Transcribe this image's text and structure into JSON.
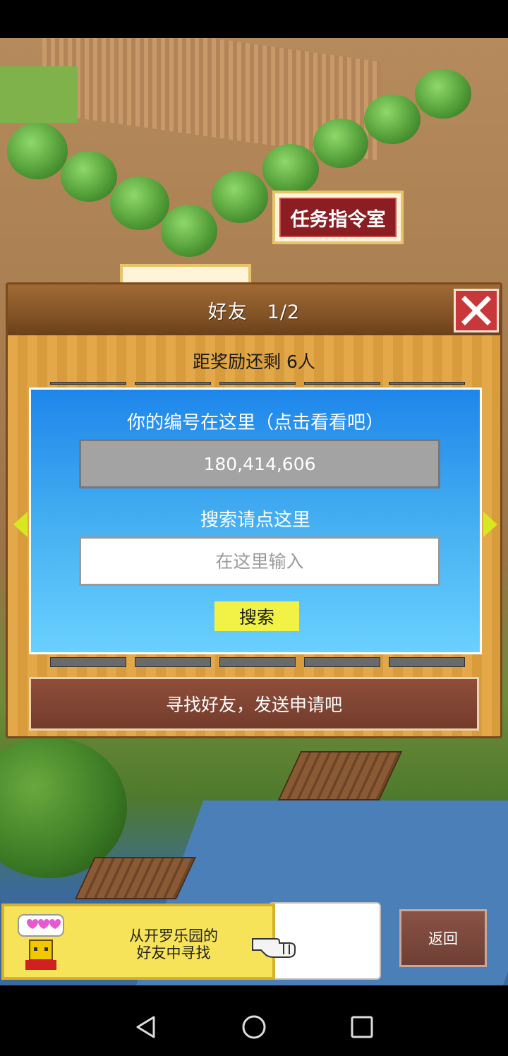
{
  "scene": {
    "mission_room_sign": "任务指令室"
  },
  "dialog": {
    "title": "好友　1/2",
    "reward_remaining": "距奖励还剩 6人",
    "id_prompt": "你的编号在这里（点击看看吧）",
    "player_id": "180,414,606",
    "search_prompt": "搜索请点这里",
    "search_placeholder": "在这里输入",
    "search_button": "搜索",
    "find_friends_button": "寻找好友，发送申请吧"
  },
  "bottom": {
    "kairo_banner_line1": "从开罗乐园的",
    "kairo_banner_line2": "好友中寻找",
    "back_button": "返回"
  },
  "colors": {
    "dialog_panel": "#1e86ea",
    "close_button": "#c8383a",
    "search_button": "#f2f246",
    "find_button": "#743c2c"
  },
  "icons": {
    "close": "close-icon",
    "page_left": "arrow-left-icon",
    "page_right": "arrow-right-icon",
    "pointer": "hand-pointer-icon",
    "nav_back": "triangle-back-icon",
    "nav_home": "circle-home-icon",
    "nav_recent": "square-recent-icon"
  }
}
